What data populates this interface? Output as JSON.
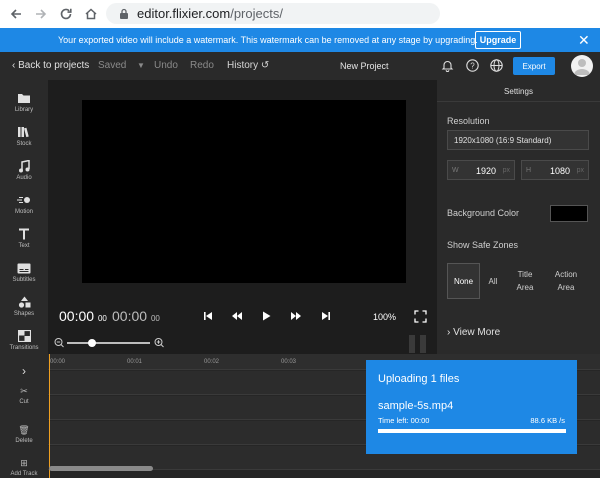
{
  "browser": {
    "url_host": "editor.flixier.com",
    "url_path": "/projects/"
  },
  "banner": {
    "message": "Your exported video will include a watermark. This watermark can be removed at any stage by upgrading.",
    "upgrade_label": "Upgrade",
    "color": "#1e88e5"
  },
  "topbar": {
    "back_label": "Back to projects",
    "saved_label": "Saved",
    "undo_label": "Undo",
    "redo_label": "Redo",
    "history_label": "History",
    "project_title": "New Project",
    "export_label": "Export",
    "icons": [
      "bell-icon",
      "help-icon",
      "globe-icon"
    ]
  },
  "tools": [
    {
      "label": "Library",
      "icon": "folder-icon"
    },
    {
      "label": "Stock",
      "icon": "books-icon"
    },
    {
      "label": "Audio",
      "icon": "music-icon"
    },
    {
      "label": "Motion",
      "icon": "motion-icon"
    },
    {
      "label": "Text",
      "icon": "text-icon"
    },
    {
      "label": "Subtitles",
      "icon": "subtitles-icon"
    },
    {
      "label": "Shapes",
      "icon": "shapes-icon"
    },
    {
      "label": "Transitions",
      "icon": "transitions-icon"
    }
  ],
  "player": {
    "current_time": "00:00",
    "current_frames": "00",
    "duration_time": "00:00",
    "duration_frames": "00",
    "zoom": "100%"
  },
  "settings": {
    "title": "Settings",
    "resolution_label": "Resolution",
    "resolution_value": "1920x1080 (16:9 Standard)",
    "width_label": "W",
    "width_value": "1920",
    "height_label": "H",
    "height_value": "1080",
    "unit": "px",
    "bg_label": "Background Color",
    "bg_color": "#000000",
    "safe_zones_label": "Show Safe Zones",
    "safe_zones": [
      "None",
      "All",
      "Title Area",
      "Action Area"
    ],
    "safe_zone_selected": "None",
    "view_more_label": "View More"
  },
  "timeline": {
    "side_items": [
      {
        "label": "",
        "icon": "chevron-right-icon"
      },
      {
        "label": "Cut",
        "icon": "scissors-icon"
      },
      {
        "label": "Delete",
        "icon": "trash-icon"
      },
      {
        "label": "Add Track",
        "icon": "add-track-icon"
      }
    ],
    "ticks": [
      "00:00",
      "00:01",
      "00:02",
      "00:03"
    ]
  },
  "upload": {
    "title": "Uploading 1 files",
    "file_name": "sample-5s.mp4",
    "time_left": "Time left: 00:00",
    "speed": "88.6 KB /s",
    "progress": 1.0
  }
}
